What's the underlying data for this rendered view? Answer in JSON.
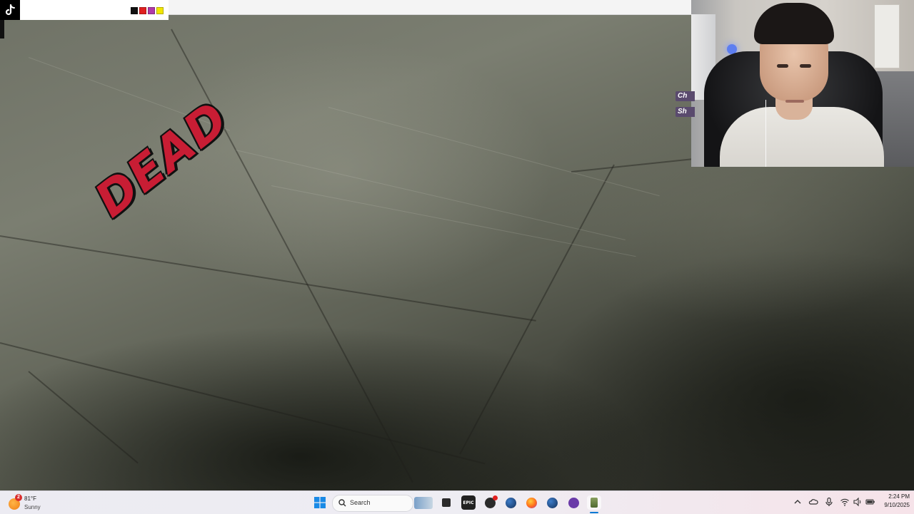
{
  "game": {
    "status_text": "DEAD"
  },
  "overlay": {
    "app_icon": "tiktok-icon",
    "color_swatches": [
      "#111111",
      "#e02020",
      "#b03aa8",
      "#f2e600"
    ]
  },
  "stream": {
    "chat_tags": [
      "Ch",
      "Sh"
    ]
  },
  "taskbar": {
    "weather": {
      "temp": "81°F",
      "condition": "Sunny",
      "badge": "2",
      "icon": "sun-icon"
    },
    "search_label": "Search",
    "pinned_apps": [
      "windows-start-icon",
      "widgets-icon",
      "file-explorer-icon",
      "epic-games-icon",
      "obs-icon",
      "steam-icon",
      "firefox-icon",
      "steam-icon-2",
      "podcast-icon",
      "game-icon"
    ],
    "tray_icons": [
      "chevron-up-icon",
      "onedrive-icon",
      "microphone-icon",
      "wifi-icon",
      "volume-icon",
      "battery-icon"
    ],
    "clock": {
      "time": "2:24 PM",
      "date": "9/10/2025"
    },
    "accent": "#0078d4"
  }
}
